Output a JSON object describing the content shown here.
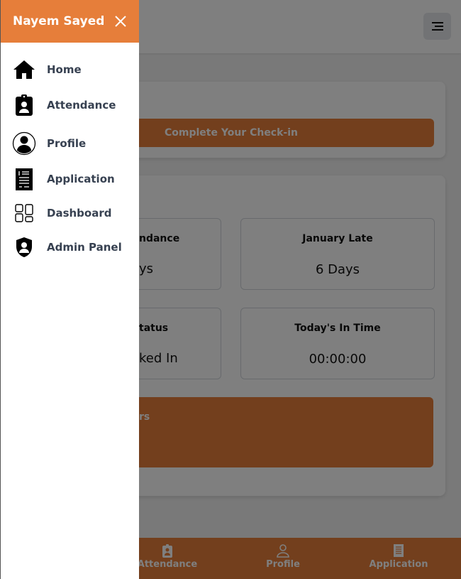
{
  "drawer": {
    "title": "Nayem Sayed",
    "items": [
      {
        "label": "Home",
        "icon": "home-icon"
      },
      {
        "label": "Attendance",
        "icon": "clipboard-user-icon"
      },
      {
        "label": "Profile",
        "icon": "user-circle-icon"
      },
      {
        "label": "Application",
        "icon": "document-icon"
      },
      {
        "label": "Dashboard",
        "icon": "grid-icon"
      },
      {
        "label": "Admin Panel",
        "icon": "shield-user-icon"
      }
    ]
  },
  "main": {
    "checkin_label": "Complete Your Check-in",
    "stats": [
      {
        "title_fragment": "ndance",
        "value_fragment": "ys"
      },
      {
        "title": "January Late",
        "value": "6 Days"
      },
      {
        "title_fragment": "tatus",
        "value_fragment": "ked In"
      },
      {
        "title": "Today's In Time",
        "value": "00:00:00"
      }
    ],
    "hours_fragment": "rs"
  },
  "bottom_nav": [
    {
      "label": "Attendance"
    },
    {
      "label": "Profile"
    },
    {
      "label": "Application"
    }
  ],
  "colors": {
    "accent": "#e67e3a",
    "text": "#374151"
  }
}
